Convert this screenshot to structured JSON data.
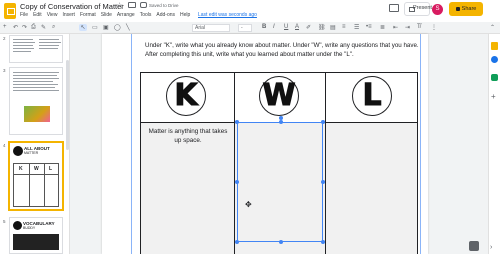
{
  "app": {
    "doc_title": "Copy of Conservation of Matter",
    "saved_status": "Saved to Drive",
    "last_edit": "Last edit was seconds ago",
    "avatar_initial": "S",
    "present_label": "Present",
    "share_label": "Share"
  },
  "menu": [
    "File",
    "Edit",
    "View",
    "Insert",
    "Format",
    "Slide",
    "Arrange",
    "Tools",
    "Add-ons",
    "Help"
  ],
  "toolbar": {
    "font_name": "Arial",
    "font_size": "-",
    "bold": "B",
    "italic": "I",
    "underline": "U",
    "text_color": "A",
    "more": "⋮"
  },
  "filmstrip": {
    "slide_numbers": [
      "2",
      "3",
      "4",
      "5"
    ],
    "thumb4_title_line1": "ALL ABOUT",
    "thumb4_title_line2": "MATTER",
    "thumb5_title_line1": "VOCABULARY",
    "thumb5_title_line2": "BUDDY",
    "kwl_letters": [
      "K",
      "W",
      "L"
    ]
  },
  "slide": {
    "instructions": "Under \"K\", write what you already know about matter. Under \"W\", write any questions that you have. After completing this unit, write what you learned about matter under the \"L\".",
    "columns": [
      "K",
      "W",
      "L"
    ],
    "k_cell_text": "Matter is anything that takes up space."
  },
  "colors": {
    "accent": "#f4b400",
    "selection": "#4285f4",
    "link": "#1a73e8"
  },
  "icons": [
    "star-icon",
    "folder-icon",
    "cloud-saved-icon",
    "comments-icon",
    "present-icon",
    "lock-icon",
    "undo-icon",
    "redo-icon",
    "print-icon",
    "paint-format-icon",
    "zoom-icon",
    "cursor-icon",
    "textbox-icon",
    "image-icon",
    "shape-icon",
    "line-icon",
    "keep-icon",
    "tasks-icon",
    "calendar-icon",
    "add-icon",
    "explore-icon",
    "collapse-icon",
    "move-crosshair-icon"
  ]
}
